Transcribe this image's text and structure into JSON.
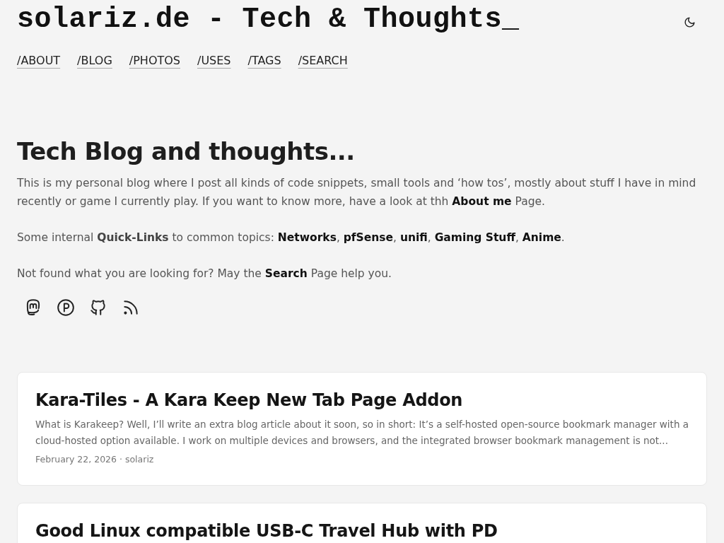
{
  "site_title": "solariz.de - Tech & Thoughts_",
  "nav": [
    "/ABOUT",
    "/BLOG",
    "/PHOTOS",
    "/USES",
    "/TAGS",
    "/SEARCH"
  ],
  "intro": {
    "heading": "Tech Blog and thoughts...",
    "paragraphs": [
      [
        {
          "kind": "text",
          "text": "This is my personal blog where I post all kinds of code snippets, small tools and ‘how tos’, mostly about stuff I have in mind recently or game I currently play. If you want to know more, have a look at thh "
        },
        {
          "kind": "link",
          "text": "About me"
        },
        {
          "kind": "text",
          "text": " Page."
        }
      ],
      [
        {
          "kind": "text",
          "text": "Some internal "
        },
        {
          "kind": "bold",
          "text": "Quick-Links"
        },
        {
          "kind": "text",
          "text": " to common topics: "
        },
        {
          "kind": "link",
          "text": "Networks"
        },
        {
          "kind": "text",
          "text": ", "
        },
        {
          "kind": "link",
          "text": "pfSense"
        },
        {
          "kind": "text",
          "text": ", "
        },
        {
          "kind": "link",
          "text": "unifi"
        },
        {
          "kind": "text",
          "text": ", "
        },
        {
          "kind": "link",
          "text": "Gaming Stuff"
        },
        {
          "kind": "text",
          "text": ", "
        },
        {
          "kind": "link",
          "text": "Anime"
        },
        {
          "kind": "text",
          "text": "."
        }
      ],
      [
        {
          "kind": "text",
          "text": "Not found what you are looking for? May the "
        },
        {
          "kind": "link",
          "text": "Search"
        },
        {
          "kind": "text",
          "text": " Page help you."
        }
      ]
    ]
  },
  "social": [
    {
      "kind": "mastodon"
    },
    {
      "kind": "p-circle"
    },
    {
      "kind": "github"
    },
    {
      "kind": "rss"
    }
  ],
  "posts": [
    {
      "title": "Kara-Tiles - A Kara Keep New Tab Page Addon",
      "excerpt": "What is Karakeep? Well, I’ll write an extra blog article about it soon, so in short: It’s a self-hosted open-source bookmark manager with a cloud-hosted option available. I work on multiple devices and browsers, and the integrated browser bookmark management is not...",
      "meta": "February 22, 2026 · solariz"
    },
    {
      "title": "Good Linux compatible USB-C Travel Hub with PD"
    }
  ]
}
